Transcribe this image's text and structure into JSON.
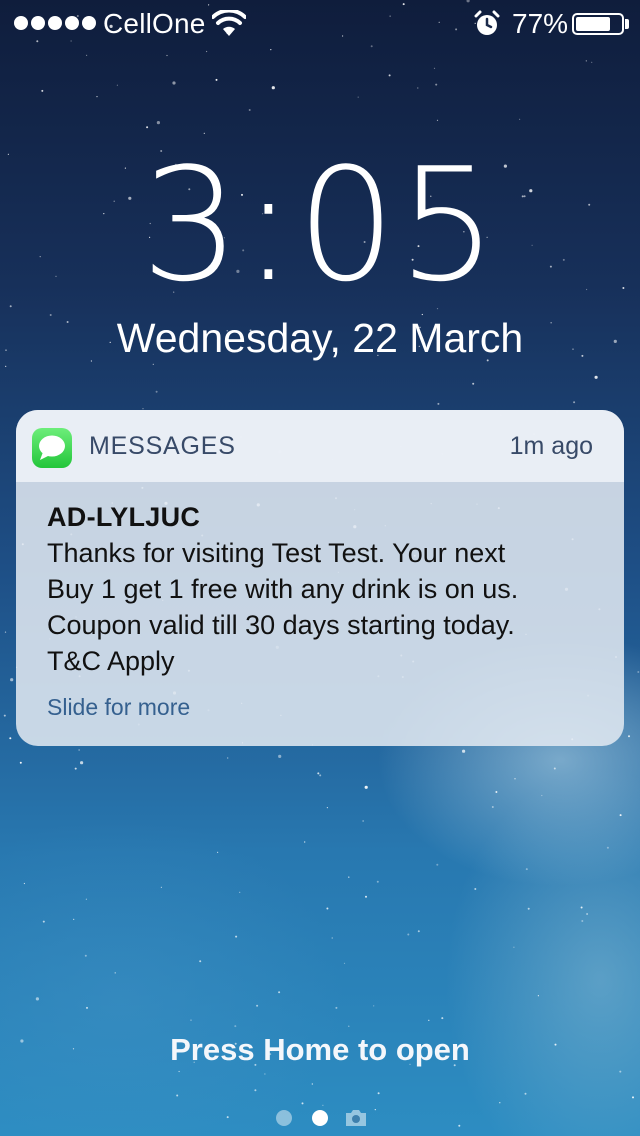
{
  "status_bar": {
    "signal_bars": 5,
    "carrier": "CellOne",
    "icons": [
      "wifi-icon",
      "alarm-clock-icon",
      "battery-icon"
    ],
    "battery_percent": "77%",
    "battery_level": 0.77
  },
  "lock_screen": {
    "time": "3:05",
    "date": "Wednesday, 22 March"
  },
  "notification": {
    "app_icon": "messages-icon",
    "app_name": "MESSAGES",
    "time_ago": "1m ago",
    "sender": "AD-LYLJUC",
    "message_lines": [
      "Thanks for visiting Test Test. Your next",
      "Buy 1 get 1 free with any drink is on us.",
      "Coupon valid till 30 days starting today.",
      "T&C Apply"
    ],
    "action_hint": "Slide for more"
  },
  "bottom": {
    "unlock_hint": "Press Home to open",
    "page_indicator": {
      "pages": 2,
      "current": 2,
      "extra_icon": "camera-icon"
    }
  },
  "colors": {
    "notification_header_text": "#384a68",
    "slide_link": "#35608f",
    "messages_green": "#23c63a"
  }
}
